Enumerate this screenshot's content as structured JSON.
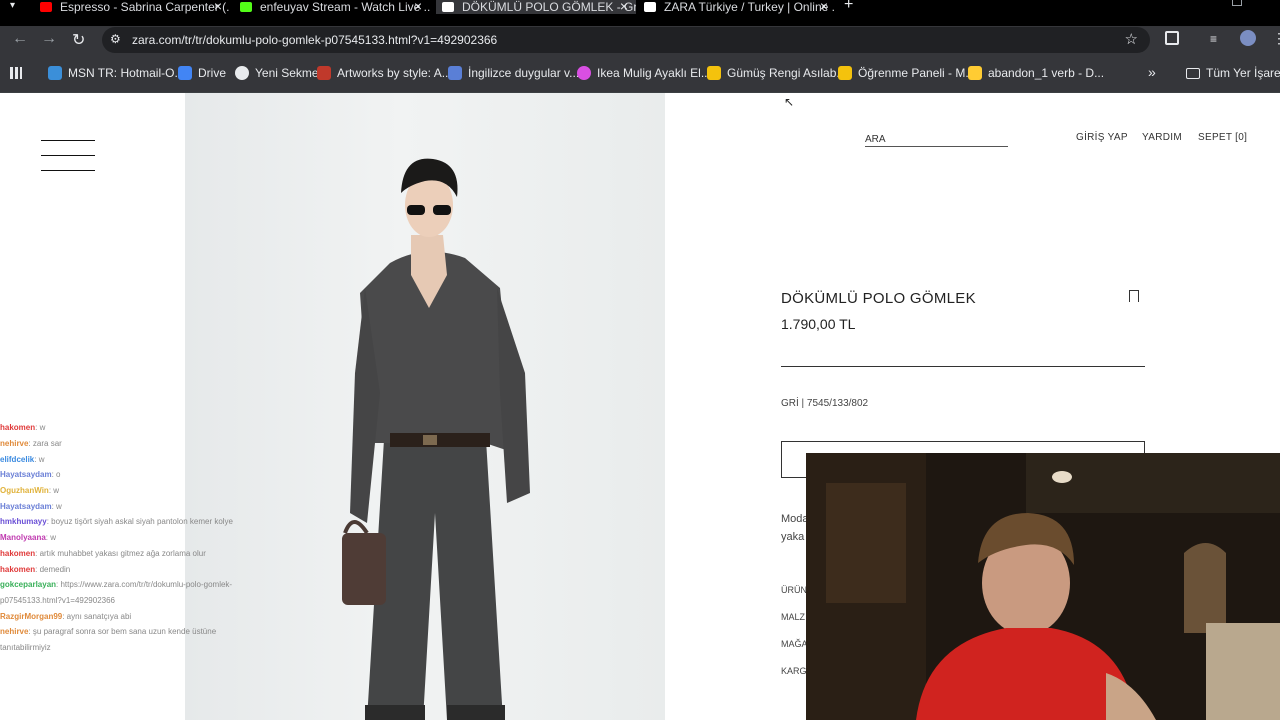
{
  "tabs": [
    {
      "title": "Espresso - Sabrina Carpenter (...",
      "favicon_color": "#ff0000",
      "active": false
    },
    {
      "title": "enfeuyav Stream - Watch Live ...",
      "favicon_color": "#53fc18",
      "active": false
    },
    {
      "title": "DÖKÜMLÜ POLO GÖMLEK - Gri ...",
      "favicon_color": "#ffffff",
      "active": true
    },
    {
      "title": "ZARA Türkiye / Turkey | Online ...",
      "favicon_color": "#ffffff",
      "active": false
    }
  ],
  "new_tab_icon": "plus-icon",
  "address_bar": {
    "url": "zara.com/tr/tr/dokumlu-polo-gomlek-p07545133.html?v1=492902366"
  },
  "bookmarks": [
    {
      "label": "MSN TR: Hotmail-O...",
      "color": "#3b8fd9"
    },
    {
      "label": "Drive",
      "color": "#4285f4"
    },
    {
      "label": "Yeni Sekme",
      "color": "#e8eaed"
    },
    {
      "label": "Artworks by style: A...",
      "color": "#c0392b"
    },
    {
      "label": "İngilizce duygular v...",
      "color": "#5a7fd6"
    },
    {
      "label": "Ikea Mulig Ayaklı El...",
      "color": "#d94fe3"
    },
    {
      "label": "Gümüş Rengi Asılab...",
      "color": "#f4c20d"
    },
    {
      "label": "Öğrenme Paneli - M...",
      "color": "#f4c20d"
    },
    {
      "label": "abandon_1 verb - D...",
      "color": "#ffcc33"
    }
  ],
  "bookmarks_overflow": "»",
  "all_bookmarks": "Tüm Yer İşaretleri",
  "site": {
    "search_label": "ARA",
    "login": "GİRİŞ YAP",
    "help": "YARDIM",
    "cart": "SEPET [0]"
  },
  "product": {
    "title": "DÖKÜMLÜ POLO GÖMLEK",
    "price": "1.790,00 TL",
    "color_ref": "GRİ | 7545/133/802",
    "description_partial": [
      "Moda",
      "yaka"
    ],
    "info_partial": [
      "ÜRÜN",
      "MALZ",
      "MAĞA",
      "KARG"
    ]
  },
  "chat": [
    {
      "user": "hakomen",
      "msg": ": w",
      "color": "#e03a3a"
    },
    {
      "user": "nehirve",
      "msg": ": zara sar",
      "color": "#e08a3a"
    },
    {
      "user": "elifdcelik",
      "msg": ": w",
      "color": "#3a8ae0"
    },
    {
      "user": "Hayatsaydam",
      "msg": ": o",
      "color": "#6a7fd6"
    },
    {
      "user": "OguzhanWin",
      "msg": ": w",
      "color": "#e0b23a"
    },
    {
      "user": "Hayatsaydam",
      "msg": ": w",
      "color": "#6a7fd6"
    },
    {
      "user": "hmkhumayy",
      "msg": ": boyuz tişört siyah askal siyah pantolon kemer kolye",
      "color": "#6a4fd6"
    },
    {
      "user": "Manolyaana",
      "msg": ": w",
      "color": "#c03ab0"
    },
    {
      "user": "hakomen",
      "msg": ": artık muhabbet yakası gitmez ağa zorlama olur",
      "color": "#e03a3a"
    },
    {
      "user": "hakomen",
      "msg": ": demedin",
      "color": "#e03a3a"
    },
    {
      "user": "gokceparlayan",
      "msg": ": https://www.zara.com/tr/tr/dokumlu-polo-gomlek-",
      "color": "#3ab05a"
    },
    {
      "user": "",
      "msg": "p07545133.html?v1=492902366",
      "color": "#888888"
    },
    {
      "user": "RazgirMorgan99",
      "msg": ": aynı sanatçıya abi",
      "color": "#e08a3a"
    },
    {
      "user": "nehirve",
      "msg": ": şu paragraf sonra sor bem sana uzun kende üstüne",
      "color": "#e08a3a"
    },
    {
      "user": "",
      "msg": "tanıtabilirmiyiz",
      "color": "#888888"
    }
  ]
}
